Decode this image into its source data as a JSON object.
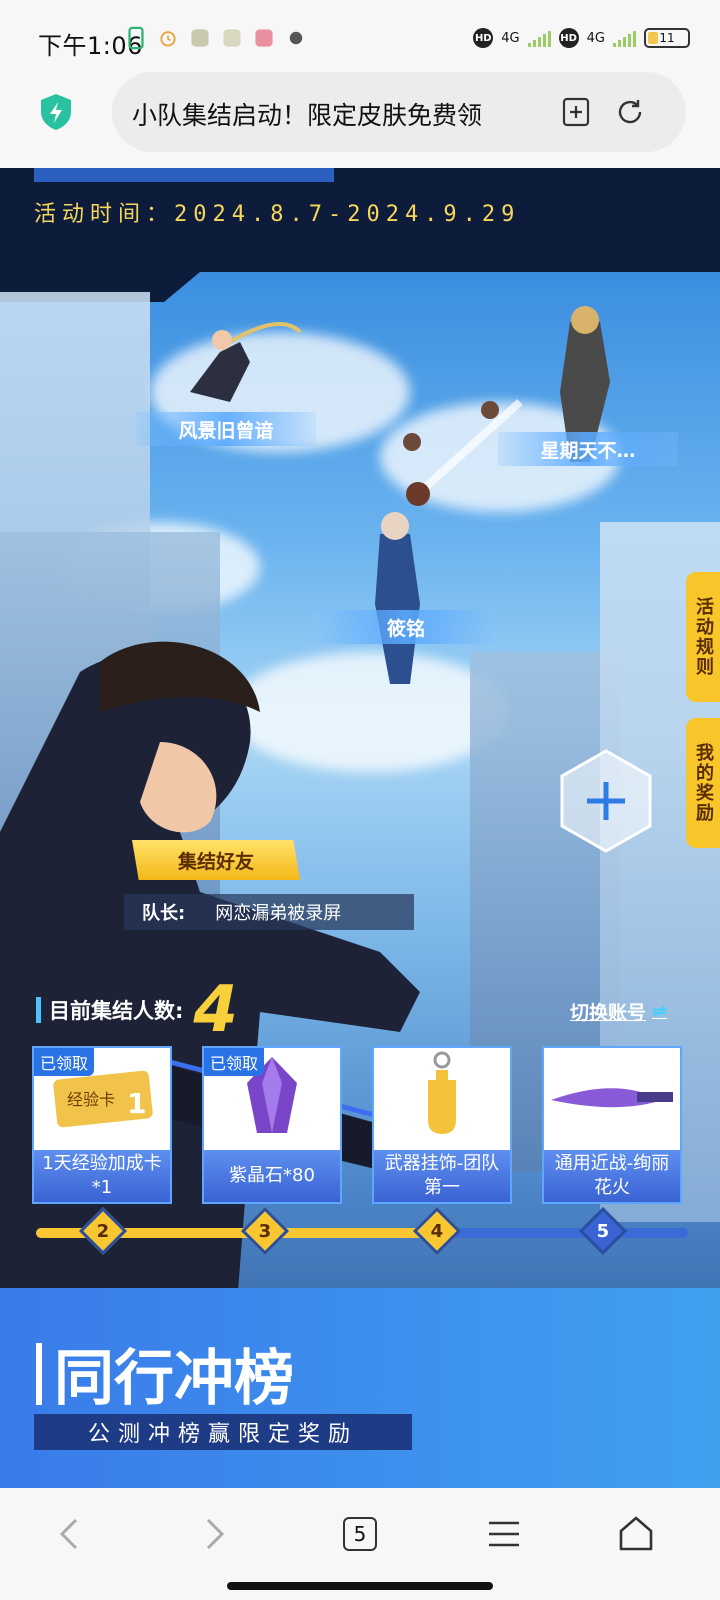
{
  "status_bar": {
    "time": "下午1:06",
    "network_1": "4G",
    "network_2": "4G",
    "battery": "11"
  },
  "browser": {
    "url_title": "小队集结启动！限定皮肤免费领"
  },
  "page": {
    "activity_time": "活动时间：2024.8.7-2024.9.29",
    "characters": [
      {
        "name": "风景旧曾谙"
      },
      {
        "name": "星期天不…"
      },
      {
        "name": "筱铭"
      }
    ],
    "side_tabs": {
      "rules": "活动规则",
      "my_rewards": "我的奖励"
    },
    "rally_button": "集结好友",
    "captain_label": "队长:",
    "captain_name": "网恋漏弟被录屏",
    "count_label": "目前集结人数:",
    "count_value": "4",
    "switch_account": "切换账号",
    "rewards": [
      {
        "label": "1天经验加成卡*1",
        "status": "已领取"
      },
      {
        "label": "紫晶石*80",
        "status": "已领取"
      },
      {
        "label": "武器挂饰-团队第一",
        "status": ""
      },
      {
        "label": "通用近战-绚丽花火",
        "status": ""
      }
    ],
    "progress_nodes": [
      "2",
      "3",
      "4",
      "5"
    ],
    "progress_fraction": 0.62,
    "section_title": "同行冲榜",
    "section_subtitle": "公测冲榜赢限定奖励"
  },
  "bottom_nav": {
    "tab_count": "5"
  },
  "colors": {
    "accent_yellow": "#f7c631",
    "accent_blue": "#3a7be9",
    "dark_navy": "#0e1c3c"
  }
}
